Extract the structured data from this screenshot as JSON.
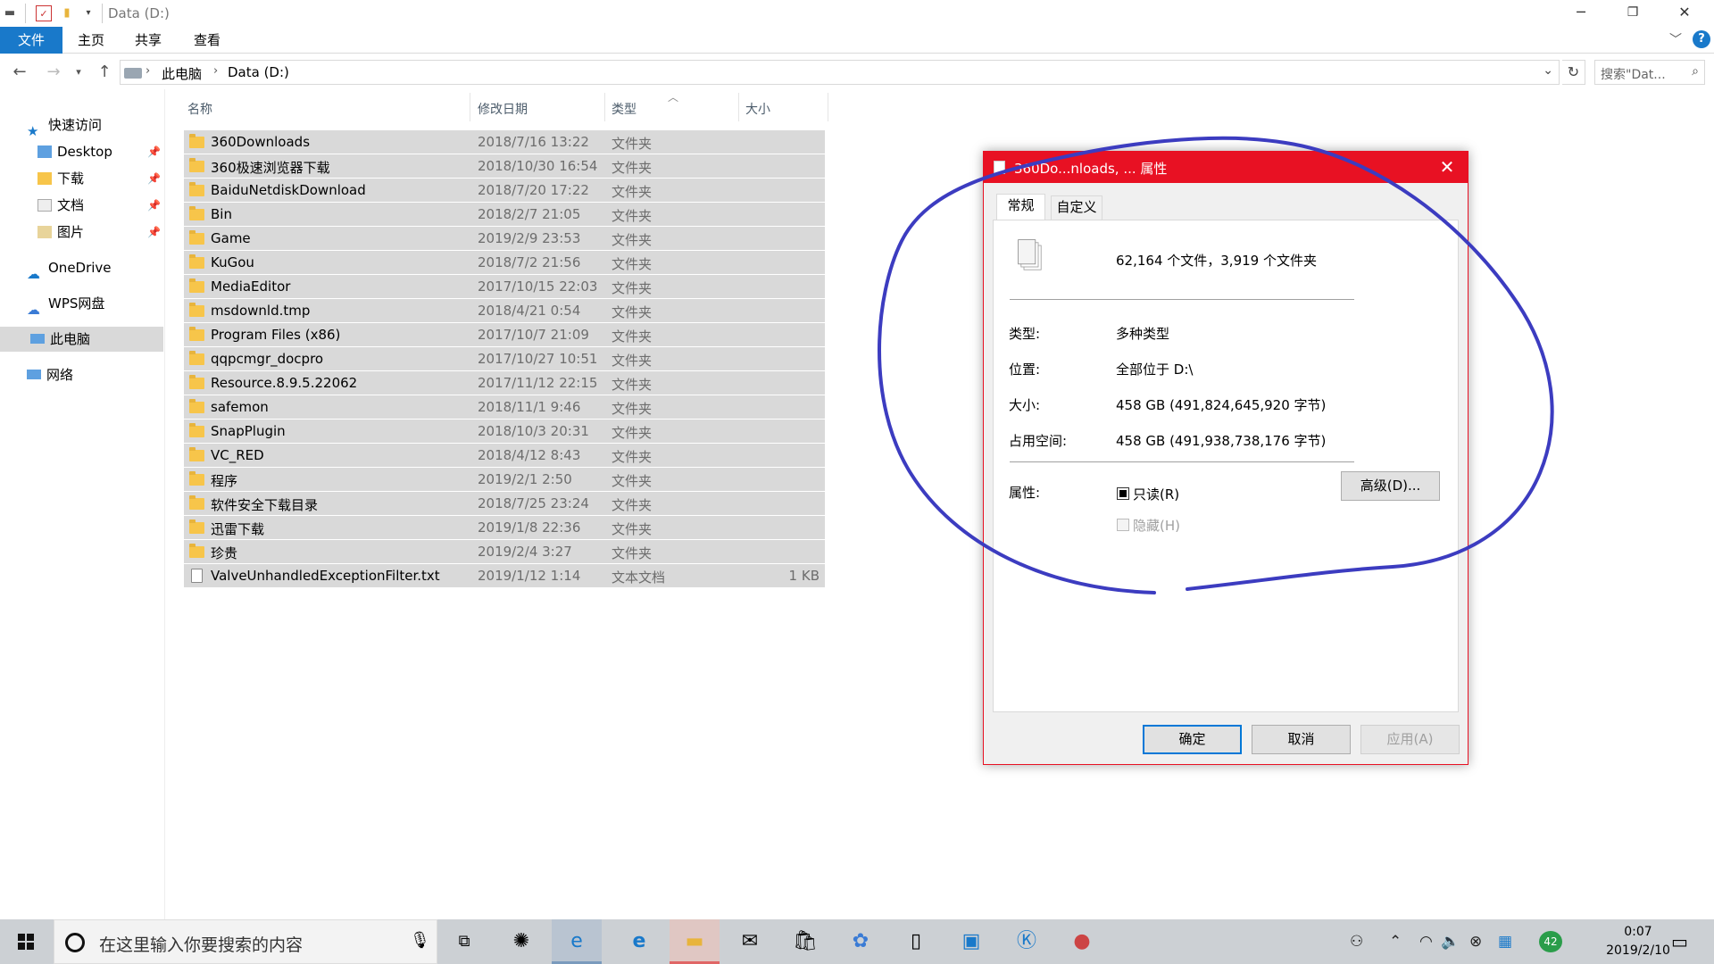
{
  "window": {
    "title": "Data (D:)"
  },
  "ribbon": {
    "tabs": [
      "文件",
      "主页",
      "共享",
      "查看"
    ]
  },
  "address": {
    "crumbs": [
      "此电脑",
      "Data (D:)"
    ],
    "search_placeholder": "搜索\"Dat..."
  },
  "sidebar": {
    "quick_access": "快速访问",
    "quick_items": [
      "Desktop",
      "下载",
      "文档",
      "图片"
    ],
    "onedrive": "OneDrive",
    "wps": "WPS网盘",
    "this_pc": "此电脑",
    "network": "网络"
  },
  "columns": {
    "name": "名称",
    "date": "修改日期",
    "type": "类型",
    "size": "大小"
  },
  "files": [
    {
      "name": "360Downloads",
      "date": "2018/7/16 13:22",
      "type": "文件夹",
      "size": ""
    },
    {
      "name": "360极速浏览器下载",
      "date": "2018/10/30 16:54",
      "type": "文件夹",
      "size": ""
    },
    {
      "name": "BaiduNetdiskDownload",
      "date": "2018/7/20 17:22",
      "type": "文件夹",
      "size": ""
    },
    {
      "name": "Bin",
      "date": "2018/2/7 21:05",
      "type": "文件夹",
      "size": ""
    },
    {
      "name": "Game",
      "date": "2019/2/9 23:53",
      "type": "文件夹",
      "size": ""
    },
    {
      "name": "KuGou",
      "date": "2018/7/2 21:56",
      "type": "文件夹",
      "size": ""
    },
    {
      "name": "MediaEditor",
      "date": "2017/10/15 22:03",
      "type": "文件夹",
      "size": ""
    },
    {
      "name": "msdownld.tmp",
      "date": "2018/4/21 0:54",
      "type": "文件夹",
      "size": ""
    },
    {
      "name": "Program Files (x86)",
      "date": "2017/10/7 21:09",
      "type": "文件夹",
      "size": ""
    },
    {
      "name": "qqpcmgr_docpro",
      "date": "2017/10/27 10:51",
      "type": "文件夹",
      "size": ""
    },
    {
      "name": "Resource.8.9.5.22062",
      "date": "2017/11/12 22:15",
      "type": "文件夹",
      "size": ""
    },
    {
      "name": "safemon",
      "date": "2018/11/1 9:46",
      "type": "文件夹",
      "size": ""
    },
    {
      "name": "SnapPlugin",
      "date": "2018/10/3 20:31",
      "type": "文件夹",
      "size": ""
    },
    {
      "name": "VC_RED",
      "date": "2018/4/12 8:43",
      "type": "文件夹",
      "size": ""
    },
    {
      "name": "程序",
      "date": "2019/2/1 2:50",
      "type": "文件夹",
      "size": ""
    },
    {
      "name": "软件安全下载目录",
      "date": "2018/7/25 23:24",
      "type": "文件夹",
      "size": ""
    },
    {
      "name": "迅雷下载",
      "date": "2019/1/8 22:36",
      "type": "文件夹",
      "size": ""
    },
    {
      "name": "珍贵",
      "date": "2019/2/4 3:27",
      "type": "文件夹",
      "size": ""
    },
    {
      "name": "ValveUnhandledExceptionFilter.txt",
      "date": "2019/1/12 1:14",
      "type": "文本文档",
      "size": "1 KB"
    }
  ],
  "dialog": {
    "title": "360Do...nloads, ... 属性",
    "tabs": [
      "常规",
      "自定义"
    ],
    "summary": "62,164 个文件，3,919 个文件夹",
    "type_label": "类型:",
    "type_value": "多种类型",
    "location_label": "位置:",
    "location_value": "全部位于 D:\\",
    "size_label": "大小:",
    "size_value": "458 GB (491,824,645,920 字节)",
    "disk_label": "占用空间:",
    "disk_value": "458 GB (491,938,738,176 字节)",
    "attr_label": "属性:",
    "readonly_label": "只读(R)",
    "readonly_checked": true,
    "hidden_label": "隐藏(H)",
    "hidden_checked": false,
    "advanced_button": "高级(D)...",
    "ok": "确定",
    "cancel": "取消",
    "apply": "应用(A)"
  },
  "taskbar": {
    "search_placeholder": "在这里输入你要搜索的内容",
    "badge": "42",
    "time": "0:07",
    "date": "2019/2/10"
  },
  "colors": {
    "accent": "#1979ca",
    "dialog_title": "#e81123",
    "selection": "#d9d9d9",
    "annotation": "#3c3cc0"
  }
}
